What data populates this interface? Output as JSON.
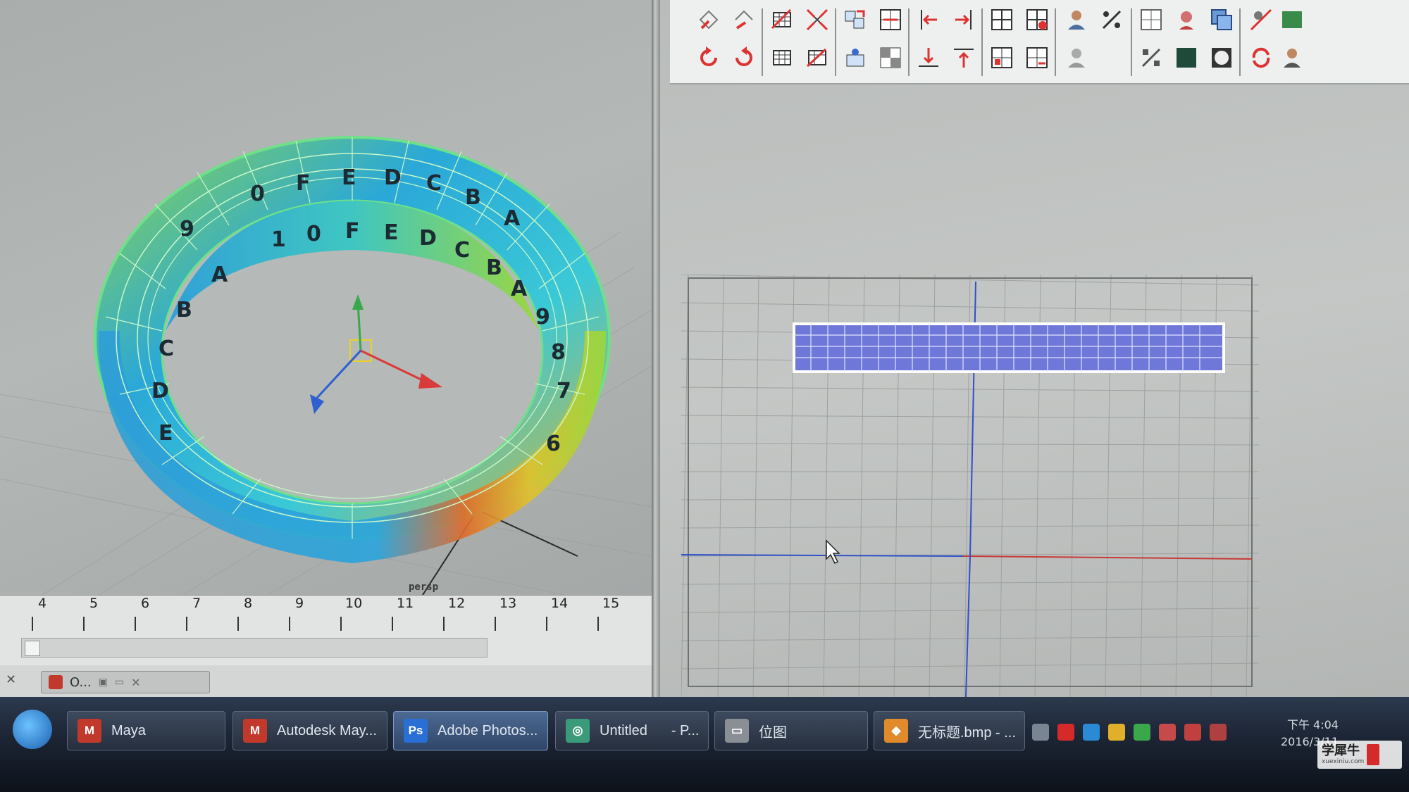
{
  "viewport": {
    "camera_label": "persp",
    "uv_letters_outer": [
      "0",
      "F",
      "E",
      "D",
      "C",
      "B",
      "A"
    ],
    "uv_letters_inner": [
      "1",
      "0",
      "F",
      "E",
      "D",
      "C",
      "B",
      "A"
    ],
    "side_letters_left": [
      "9",
      "A",
      "B",
      "C",
      "D",
      "E"
    ],
    "side_letters_right": [
      "9",
      "8",
      "7",
      "6"
    ]
  },
  "timeline": {
    "ticks": [
      "4",
      "5",
      "6",
      "7",
      "8",
      "9",
      "10",
      "11",
      "12",
      "13",
      "14",
      "15"
    ]
  },
  "minimized_window": {
    "label": "O..."
  },
  "taskbar": {
    "items": [
      {
        "label": "Maya",
        "icon": "maya-icon",
        "color": "#c0392b"
      },
      {
        "label": "Autodesk May...",
        "icon": "maya-icon",
        "color": "#c0392b"
      },
      {
        "label": "Adobe Photos...",
        "icon": "photoshop-icon",
        "color": "#2a6fd6",
        "glyph": "Ps"
      },
      {
        "label": "Untitled",
        "suffix": "- P...",
        "icon": "app-icon",
        "color": "#3a9a7a"
      },
      {
        "label": "位图",
        "icon": "drive-icon",
        "color": "#8a8f96"
      },
      {
        "label": "无标题.bmp - ...",
        "icon": "paint-icon",
        "color": "#e08a2c"
      }
    ]
  },
  "clock": {
    "time": "下午 4:04",
    "date": "2016/3/11"
  },
  "watermark": {
    "text": "学犀牛",
    "sub": "xuexiniu.com"
  },
  "colors": {
    "mesh_green": "#6fe08a",
    "uv_shell": "#6f78d8",
    "axis_red": "#d93a3a",
    "axis_green": "#3aa84a",
    "axis_blue": "#2f5fd0"
  }
}
